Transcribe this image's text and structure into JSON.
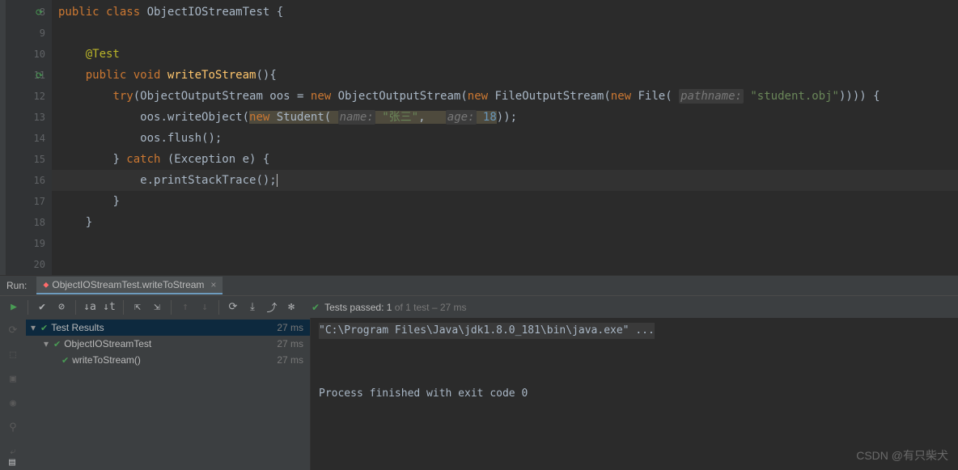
{
  "code": {
    "lines": [
      8,
      9,
      10,
      11,
      12,
      13,
      14,
      15,
      16,
      17,
      18,
      19,
      20
    ],
    "l8_public": "public",
    "l8_class": "class",
    "l8_name": "ObjectIOStreamTest",
    "l8_brace": " {",
    "l10_anno": "@Test",
    "l11_public": "public",
    "l11_void": "void",
    "l11_method": "writeToStream",
    "l11_par": "(){",
    "l12_try": "try",
    "l12_oos1": "(ObjectOutputStream oos = ",
    "l12_new1": "new",
    "l12_cls1": " ObjectOutputStream(",
    "l12_new2": "new",
    "l12_cls2": " FileOutputStream(",
    "l12_new3": "new",
    "l12_cls3": " File( ",
    "l12_hint_path": "pathname:",
    "l12_str1": " \"student.obj\"",
    "l12_end": ")))) {",
    "l13_pre": "oos.writeObject(",
    "l13_new": "new",
    "l13_stu": " Student( ",
    "l13_hint_name": "name:",
    "l13_str": " \"张三\"",
    "l13_comma": ",   ",
    "l13_hint_age": "age:",
    "l13_num": " 18",
    "l13_end": "));",
    "l14": "oos.flush();",
    "l15_close": "} ",
    "l15_catch": "catch",
    "l15_rest": " (Exception e) {",
    "l16": "e.printStackTrace();",
    "l17": "}",
    "l18": "}"
  },
  "run": {
    "label": "Run:",
    "tab": "ObjectIOStreamTest.writeToStream",
    "status_passed": "Tests passed: 1",
    "status_rest": " of 1 test – 27 ms"
  },
  "tree": {
    "root": "Test Results",
    "root_time": "27 ms",
    "class": "ObjectIOStreamTest",
    "class_time": "27 ms",
    "method": "writeToStream()",
    "method_time": "27 ms"
  },
  "console": {
    "cmd": "\"C:\\Program Files\\Java\\jdk1.8.0_181\\bin\\java.exe\" ...",
    "exit": "Process finished with exit code 0"
  },
  "watermark": "CSDN @有只柴犬"
}
